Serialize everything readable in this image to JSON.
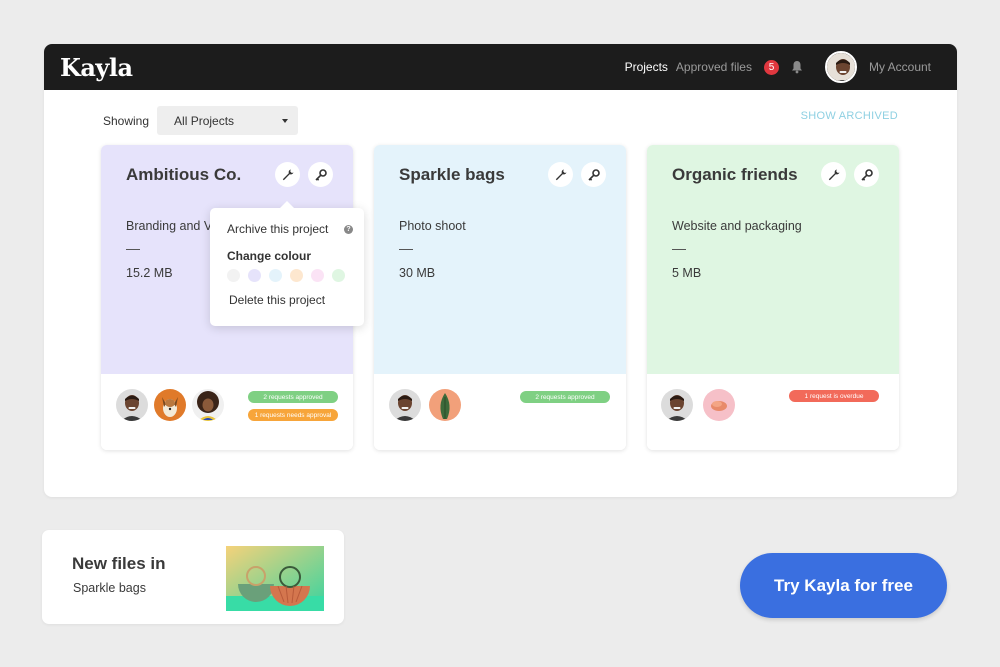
{
  "app": {
    "logo": "Kayla"
  },
  "nav": {
    "projects": "Projects",
    "approved_files": "Approved files",
    "notifications_count": "5",
    "account": "My Account"
  },
  "filter": {
    "showing_label": "Showing",
    "selected": "All Projects",
    "show_archived": "SHOW ARCHIVED"
  },
  "projects": [
    {
      "name": "Ambitious Co.",
      "description": "Branding and V",
      "dash": "—",
      "size": "15.2 MB",
      "color": "#e6e3fb",
      "badges": [
        {
          "text": "2 requests approved",
          "color": "#7fd083"
        },
        {
          "text": "1 requests needs approval",
          "color": "#f7a53a"
        }
      ]
    },
    {
      "name": "Sparkle bags",
      "description": "Photo shoot",
      "dash": "—",
      "size": "30 MB",
      "color": "#e4f3fb",
      "badges": [
        {
          "text": "2 requests approved",
          "color": "#7fd083"
        }
      ]
    },
    {
      "name": "Organic friends",
      "description": "Website and packaging",
      "dash": "—",
      "size": "5 MB",
      "color": "#dff6e2",
      "badges": [
        {
          "text": "1 request is overdue",
          "color": "#f26a5a"
        }
      ]
    }
  ],
  "popover": {
    "archive": "Archive this project",
    "help": "?",
    "change_colour": "Change colour",
    "swatches": [
      "#f2f2f2",
      "#e6e3fb",
      "#e4f3fb",
      "#fde7cf",
      "#fbe3f5",
      "#dff6e2"
    ],
    "delete": "Delete this project"
  },
  "new_files": {
    "title": "New files in",
    "project": "Sparkle bags"
  },
  "cta": {
    "label": "Try Kayla for free"
  }
}
